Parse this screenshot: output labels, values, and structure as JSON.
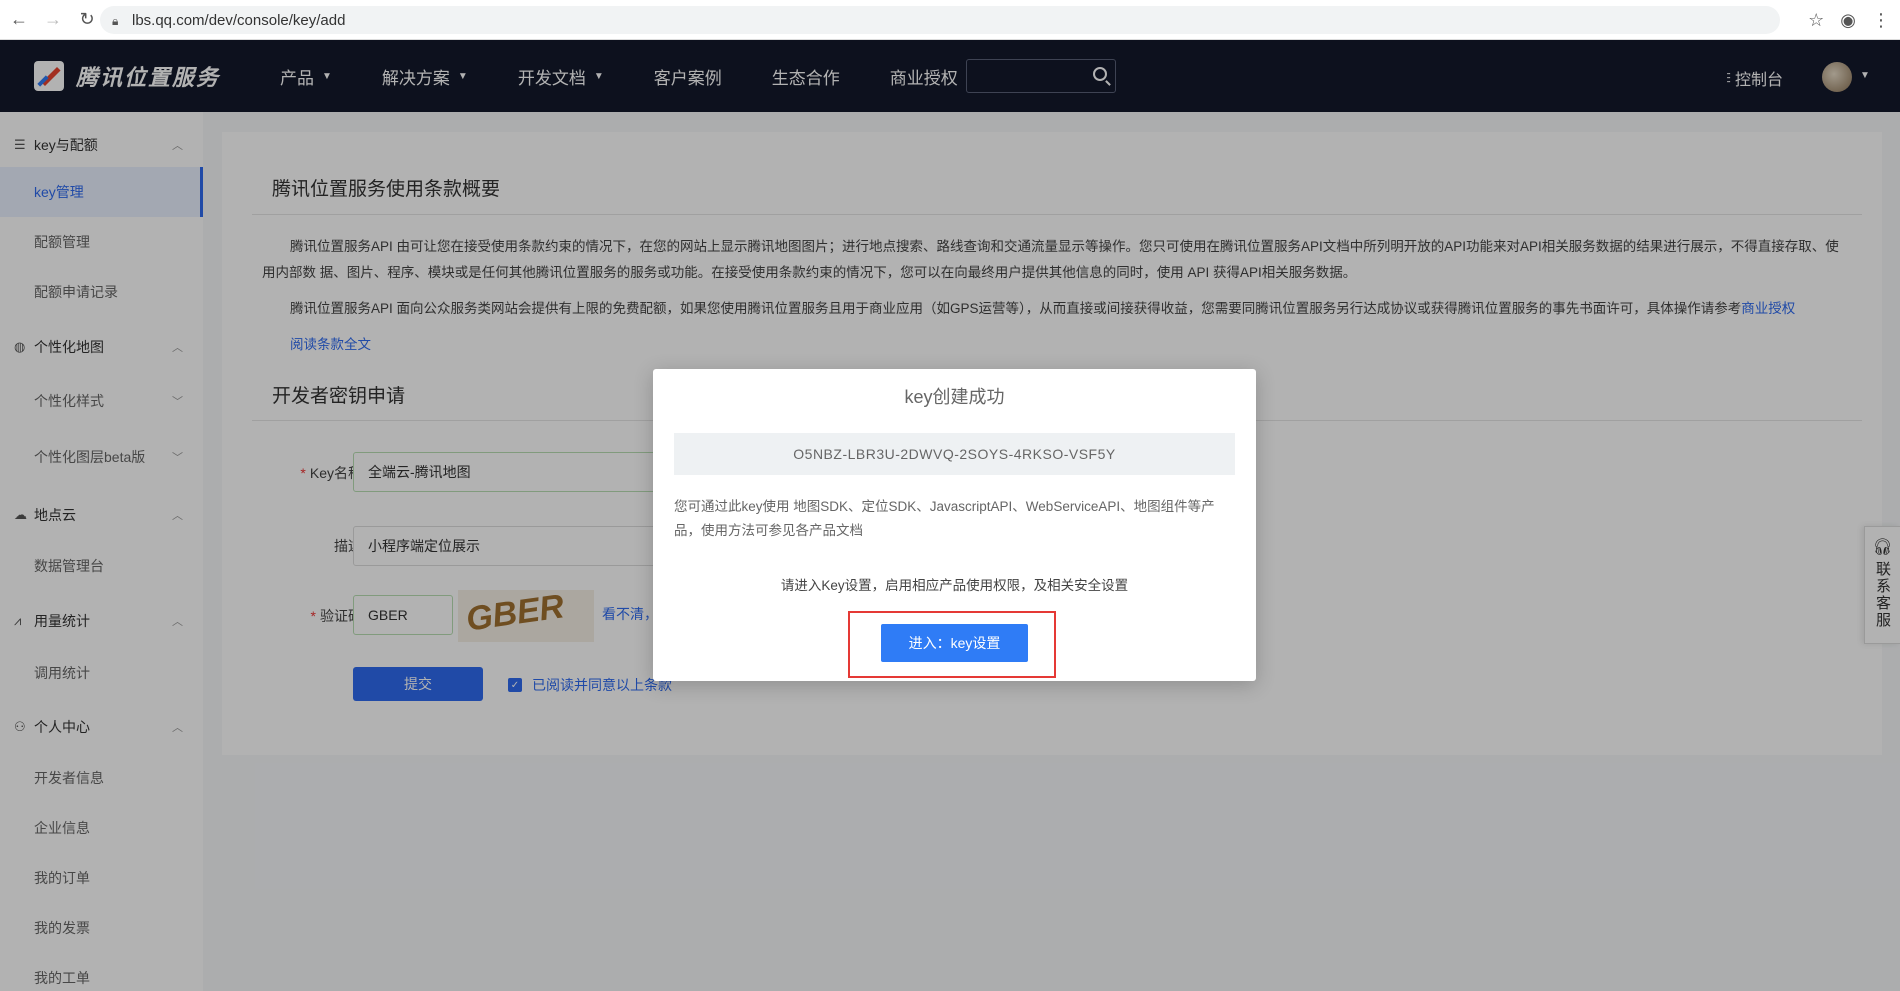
{
  "browser": {
    "url": "lbs.qq.com/dev/console/key/add"
  },
  "header": {
    "brand": "腾讯位置服务",
    "nav": [
      "产品",
      "解决方案",
      "开发文档",
      "客户案例",
      "生态合作",
      "商业授权"
    ],
    "console": "控制台"
  },
  "sidebar": {
    "groups": [
      {
        "label": "key与配额",
        "items": [
          "key管理",
          "配额管理",
          "配额申请记录"
        ]
      },
      {
        "label": "个性化地图",
        "items": [
          "个性化样式",
          "个性化图层beta版"
        ]
      },
      {
        "label": "地点云",
        "items": [
          "数据管理台"
        ]
      },
      {
        "label": "用量统计",
        "items": [
          "调用统计"
        ]
      },
      {
        "label": "个人中心",
        "items": [
          "开发者信息",
          "企业信息",
          "我的订单",
          "我的发票",
          "我的工单"
        ]
      }
    ],
    "active": "key管理"
  },
  "terms": {
    "title": "腾讯位置服务使用条款概要",
    "para1": "腾讯位置服务API 由可让您在接受使用条款约束的情况下，在您的网站上显示腾讯地图图片；进行地点搜索、路线查询和交通流量显示等操作。您只可使用在腾讯位置服务API文档中所列明开放的API功能来对API相关服务数据的结果进行展示，不得直接存取、使用内部数 据、图片、程序、模块或是任何其他腾讯位置服务的服务或功能。在接受使用条款约束的情况下，您可以在向最终用户提供其他信息的同时，使用 API 获得API相关服务数据。",
    "para2": "腾讯位置服务API 面向公众服务类网站会提供有上限的免费配额，如果您使用腾讯位置服务且用于商业应用（如GPS运营等），从而直接或间接获得收益，您需要同腾讯位置服务另行达成协议或获得腾讯位置服务的事先书面许可，具体操作请参考",
    "para2_link": "商业授权",
    "read_full": "阅读条款全文"
  },
  "form": {
    "title": "开发者密钥申请",
    "key_name_label": "Key名称",
    "key_name_value": "全端云-腾讯地图",
    "desc_label": "描述",
    "desc_value": "小程序端定位展示",
    "captcha_label": "验证码",
    "captcha_value": "GBER",
    "captcha_image_text": "GBER",
    "captcha_refresh": "看不清，",
    "submit": "提交",
    "agree": "已阅读并同意以上条款"
  },
  "service_tab": "联系客服",
  "modal": {
    "title": "key创建成功",
    "key": "O5NBZ-LBR3U-2DWVQ-2SOYS-4RKSO-VSF5Y",
    "desc": "您可通过此key使用 地图SDK、定位SDK、JavascriptAPI、WebServiceAPI、地图组件等产品，使用方法可参见各产品文档",
    "tip": "请进入Key设置，启用相应产品使用权限，及相关安全设置",
    "button": "进入：key设置"
  },
  "colors": {
    "brand_blue": "#2f6bf0",
    "header_bg": "#13192c",
    "highlight_red": "#e53935"
  }
}
